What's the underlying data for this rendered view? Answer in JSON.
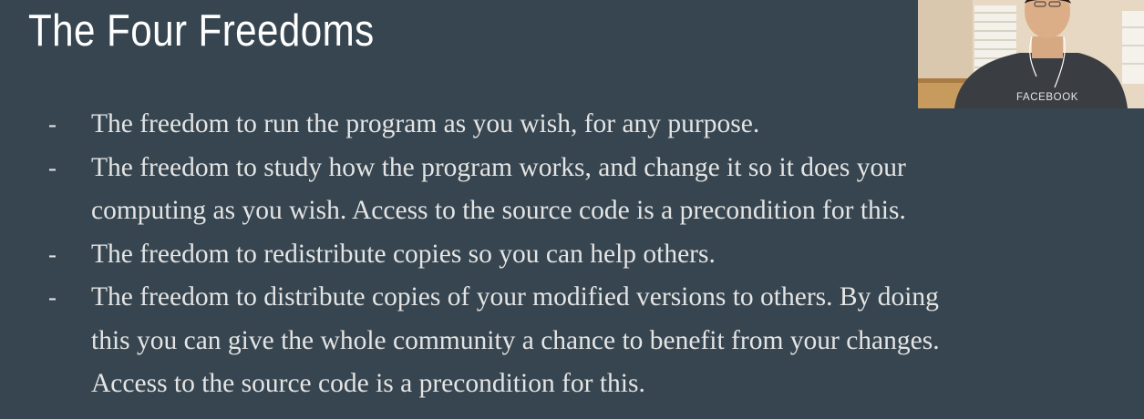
{
  "slide": {
    "title": "The Four Freedoms",
    "bullet_marker": "-",
    "bullets": [
      {
        "lines": [
          "The freedom to run the program as you wish, for any purpose."
        ]
      },
      {
        "lines": [
          "The freedom to study how the program works, and change it so it does your",
          "computing as you wish. Access to the source code is a precondition for this."
        ]
      },
      {
        "lines": [
          "The freedom to redistribute copies so you can help others."
        ]
      },
      {
        "lines": [
          "The freedom to distribute copies of your modified versions to others. By doing",
          "this you can give the whole community a chance to benefit from your changes.",
          "Access to the source code is a precondition for this."
        ]
      }
    ],
    "background_color": "#36454f"
  },
  "webcam": {
    "shirt_text": "FACEBOOK"
  }
}
